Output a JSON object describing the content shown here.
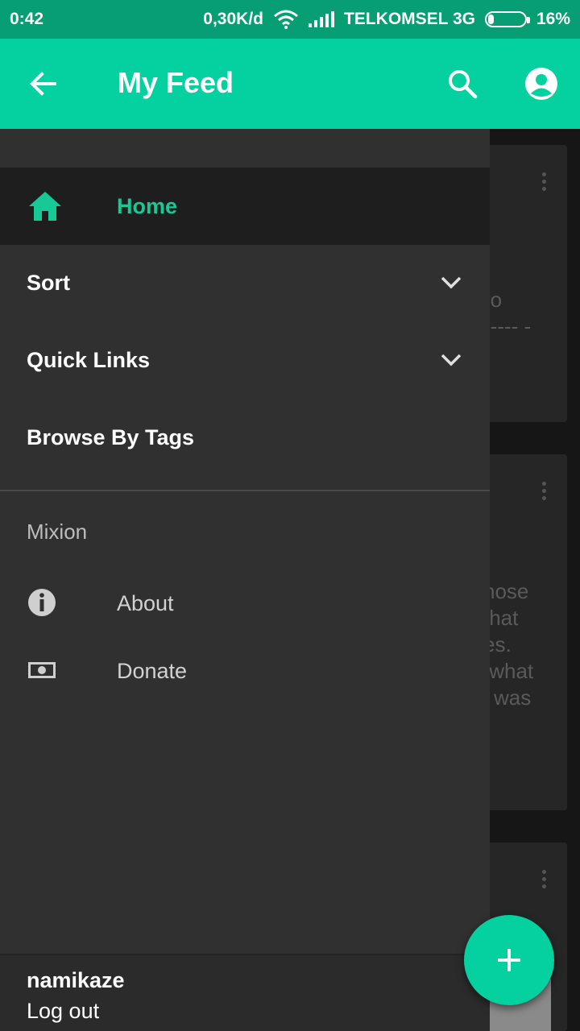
{
  "status_bar": {
    "time": "0:42",
    "net_speed": "0,30K/d",
    "carrier": "TELKOMSEL 3G",
    "battery": "16%",
    "battery_level": 0.16
  },
  "app_bar": {
    "title": "My Feed",
    "back_icon": "arrow-back-icon",
    "search_icon": "search-icon",
    "account_icon": "account-circle-icon"
  },
  "drawer": {
    "home": {
      "label": "Home",
      "icon": "home-icon"
    },
    "sort": {
      "label": "Sort"
    },
    "quick_links": {
      "label": "Quick Links"
    },
    "browse_by_tags": {
      "label": "Browse By Tags"
    },
    "section_title": "Mixion",
    "about": {
      "label": "About",
      "icon": "info-icon"
    },
    "donate": {
      "label": "Donate",
      "icon": "money-icon"
    },
    "footer": {
      "username": "namikaze",
      "logout": "Log out"
    }
  },
  "feed": {
    "card1_text": "ro\n----- -",
    "card2_text": "hose\nthat\nes.\n what\ni was"
  },
  "colors": {
    "accent": "#04d19f",
    "status_bar": "#079e74",
    "drawer_bg": "#303030",
    "home_active": "#16c995"
  }
}
